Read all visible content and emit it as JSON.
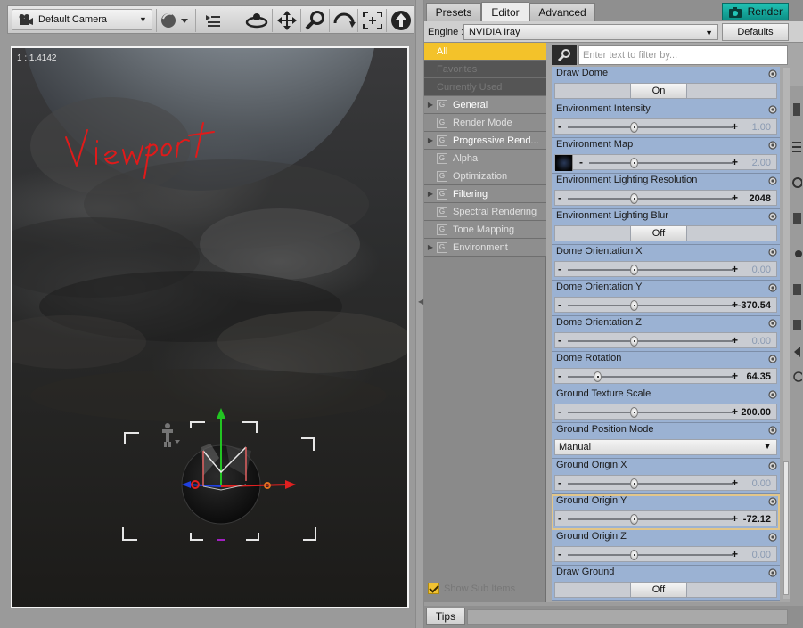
{
  "viewport": {
    "camera": "Default Camera",
    "aspect_ratio": "1 : 1.4142",
    "annotation": "Viewport"
  },
  "tabs": [
    "Presets",
    "Editor",
    "Advanced"
  ],
  "active_tab": "Editor",
  "render_button": "Render",
  "engine": {
    "label": "Engine :",
    "value": "NVIDIA Iray",
    "defaults_button": "Defaults"
  },
  "filter": {
    "placeholder": "Enter text to filter by..."
  },
  "categories": [
    {
      "label": "All",
      "state": "selected"
    },
    {
      "label": "Favorites",
      "state": "disabled"
    },
    {
      "label": "Currently Used",
      "state": "disabled"
    },
    {
      "label": "General",
      "state": "group",
      "expandable": true,
      "bright": true
    },
    {
      "label": "Render Mode",
      "state": "group",
      "expandable": false
    },
    {
      "label": "Progressive Rend...",
      "state": "group",
      "expandable": true,
      "bright": true
    },
    {
      "label": "Alpha",
      "state": "group",
      "expandable": false
    },
    {
      "label": "Optimization",
      "state": "group",
      "expandable": false
    },
    {
      "label": "Filtering",
      "state": "group",
      "expandable": true,
      "bright": true
    },
    {
      "label": "Spectral Rendering",
      "state": "group",
      "expandable": false
    },
    {
      "label": "Tone Mapping",
      "state": "group",
      "expandable": false
    },
    {
      "label": "Environment",
      "state": "group",
      "expandable": true
    }
  ],
  "show_sub_items": "Show Sub Items",
  "properties": [
    {
      "name": "Draw Dome",
      "kind": "toggle",
      "value": "On"
    },
    {
      "name": "Environment Intensity",
      "kind": "slider",
      "value": "1.00",
      "position": 0.4,
      "dim": true
    },
    {
      "name": "Environment Map",
      "kind": "map-slider",
      "value": "2.00",
      "position": 0.4,
      "dim": true
    },
    {
      "name": "Environment Lighting Resolution",
      "kind": "slider",
      "value": "2048",
      "position": 0.4,
      "dim": false
    },
    {
      "name": "Environment Lighting Blur",
      "kind": "toggle",
      "value": "Off"
    },
    {
      "name": "Dome Orientation X",
      "kind": "slider",
      "value": "0.00",
      "position": 0.4,
      "dim": true
    },
    {
      "name": "Dome Orientation Y",
      "kind": "slider",
      "value": "-370.54",
      "position": 0.4,
      "dim": false
    },
    {
      "name": "Dome Orientation Z",
      "kind": "slider",
      "value": "0.00",
      "position": 0.4,
      "dim": true
    },
    {
      "name": "Dome Rotation",
      "kind": "slider",
      "value": "64.35",
      "position": 0.18,
      "dim": false
    },
    {
      "name": "Ground Texture Scale",
      "kind": "slider",
      "value": "200.00",
      "position": 0.4,
      "dim": false
    },
    {
      "name": "Ground Position Mode",
      "kind": "dropdown",
      "value": "Manual"
    },
    {
      "name": "Ground Origin X",
      "kind": "slider",
      "value": "0.00",
      "position": 0.4,
      "dim": true
    },
    {
      "name": "Ground Origin Y",
      "kind": "slider",
      "value": "-72.12",
      "position": 0.4,
      "dim": false,
      "selected": true
    },
    {
      "name": "Ground Origin Z",
      "kind": "slider",
      "value": "0.00",
      "position": 0.4,
      "dim": true
    },
    {
      "name": "Draw Ground",
      "kind": "toggle",
      "value": "Off"
    }
  ],
  "tips_tab": "Tips",
  "colors": {
    "accent_selected": "#f3c22a",
    "property_bg": "#9bb2d3",
    "render_button": "#14a89d",
    "annotation": "#e01010"
  }
}
